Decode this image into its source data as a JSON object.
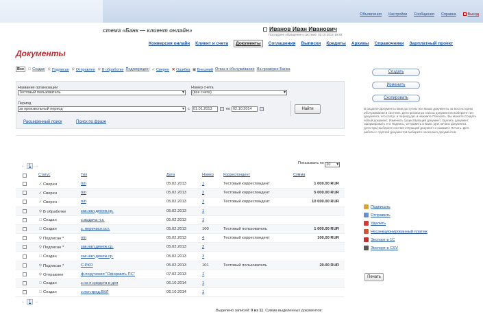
{
  "header": {
    "app_title": "стема «Банк — клиент онлайн»",
    "user_name": "Иванов Иван Иванович",
    "last_login": "Последнее обращение к системе: 02.10.2014 16:48",
    "top_links": [
      "Объявления",
      "Настройки",
      "Сообщения",
      "Справка"
    ],
    "exit_label": "Выход"
  },
  "nav": {
    "items": [
      "Конверсия онлайн",
      "Клиент и счета",
      "Документы",
      "Соглашения",
      "Выписки",
      "Кредиты",
      "Архивы",
      "Справочники",
      "Зарплатный проект"
    ],
    "active": "Документы"
  },
  "page_title": "Документы",
  "filters": {
    "all": "Все",
    "items": [
      {
        "icon": "doc",
        "label": "Создан"
      },
      {
        "icon": "sign",
        "label": "Подписан"
      },
      {
        "icon": "send",
        "label": "Отправлен"
      },
      {
        "icon": "process",
        "label": "В обработке"
      },
      {
        "icon": "none",
        "label": "Подтвержден"
      },
      {
        "icon": "check",
        "label": "Сверен"
      },
      {
        "icon": "cross",
        "label": "Ошибка"
      },
      {
        "icon": "ext",
        "label": "Внешний"
      },
      {
        "icon": "none",
        "label": "Отказ в обслуживании"
      },
      {
        "icon": "none",
        "label": "На проверке Банка"
      }
    ]
  },
  "form": {
    "org_label": "Название организации",
    "org_value": "Тестовый пользователь",
    "acc_label": "Номер счёта",
    "acc_value": "(все счета)",
    "period_label": "Период",
    "period_value": "за произвольный период",
    "from_prefix": "с",
    "date_from": "01.01.2013",
    "to_prefix": "по",
    "date_to": "02.10.2014",
    "find_button": "Найти",
    "advanced_search": "Расширенный поиск",
    "phrase_search": "Поиск по фразе"
  },
  "table": {
    "page": "1",
    "show_by_label": "Показывать по",
    "show_by_value": "20",
    "headers": [
      "Статус",
      "Тип",
      "Дата",
      "Номер",
      "Корреспондент",
      "Сумма"
    ],
    "rows": [
      {
        "status": "Сверен",
        "icon": "check",
        "type": "п/п",
        "date": "05.02.2013",
        "num": "1",
        "corr": "Тестовый корреспондент",
        "amount": "1 000.00 RUR"
      },
      {
        "status": "Сверен",
        "icon": "check",
        "type": "п/п",
        "date": "05.02.2013",
        "num": "2",
        "corr": "Тестовый корреспондент",
        "amount": "5 000.00 RUR"
      },
      {
        "status": "Сверен",
        "icon": "check",
        "type": "п/п",
        "date": "05.02.2013",
        "num": "3",
        "corr": "Тестовый корреспондент",
        "amount": "10 000.00 RUR"
      },
      {
        "status": "В обработке",
        "icon": "process",
        "type": "зак.нал.денеж.ср.",
        "date": "05.02.2013",
        "num": "1",
        "corr": "",
        "amount": ""
      },
      {
        "status": "Создан",
        "icon": "doc",
        "type": "з.выдача ч.к.",
        "date": "05.02.2013",
        "num": "1",
        "corr": "",
        "amount": ""
      },
      {
        "status": "Создан",
        "icon": "doc",
        "type": "з. перечисл.ост.",
        "date": "05.02.2013",
        "num": "100",
        "corr": "Тестовый пользователь",
        "amount": "1 000.00 RUR"
      },
      {
        "status": "Подписан *",
        "icon": "sign",
        "type": "п/п",
        "date": "05.02.2013",
        "num": "4",
        "corr": "Тестовый корреспондент",
        "amount": "100.00 RUR"
      },
      {
        "status": "Подписан *",
        "icon": "sign",
        "type": "зак.нал.денеж.ср.",
        "date": "05.02.2013",
        "num": "2",
        "corr": "",
        "amount": ""
      },
      {
        "status": "Создан",
        "icon": "doc",
        "type": "зак.нал.денеж.ср.",
        "date": "05.02.2013",
        "num": "3",
        "corr": "",
        "amount": ""
      },
      {
        "status": "Подписан *",
        "icon": "sign",
        "type": "С.РКО",
        "date": "05.02.2013",
        "num": "101",
        "corr": "Тестовый пользователь",
        "amount": "20.00 RUR"
      },
      {
        "status": "Отправлен",
        "icon": "send",
        "type": "ф.поручения \"Оформить ПС\"",
        "date": "07.02.2013",
        "num": "1",
        "corr": "",
        "amount": ""
      },
      {
        "status": "Создан",
        "icon": "doc",
        "type": "з.на п.средств в деп",
        "date": "06.10.2014",
        "num": "1",
        "corr": "",
        "amount": ""
      },
      {
        "status": "Создан",
        "icon": "doc",
        "type": "з.пол.кред.ВКЛ",
        "date": "06.10.2014",
        "num": "1",
        "corr": "",
        "amount": ""
      }
    ],
    "selected_prefix": "Выделено записей: ",
    "selected_count": "0 из 11",
    "selected_suffix": ". Сумма выделенных документов:"
  },
  "right_panel": {
    "create": "Создать",
    "edit": "Изменить",
    "copy": "Скопировать",
    "help_text": "В разделе Документы Вам доступны все Ваши документы за всю историю обслуживания в системе. Для просмотра списка документов выберите тип документа, его статус и период дат и нажмите Показать. Вы можете Создать новый документ, Изменить существующий документ, Удалить документ, сформировать его Подпись, Отправить в Банк. Для печати документа (реестра) выберите соответствующий документ и нажмите Печать. Для работы с группой документов выберите несколько документов.",
    "actions": [
      {
        "label": "Подписать",
        "color": "#d9a441"
      },
      {
        "label": "Отправить",
        "color": "#6a8fcf"
      },
      {
        "label": "Удалить",
        "color": "#d03a3a"
      },
      {
        "label": "Несанкционированный платеж",
        "color": "#c9573a"
      },
      {
        "label": "Экспорт в 1С",
        "color": "#c03030"
      },
      {
        "label": "Экспорт в CSV",
        "color": "#555555"
      }
    ],
    "print": "Печать"
  }
}
